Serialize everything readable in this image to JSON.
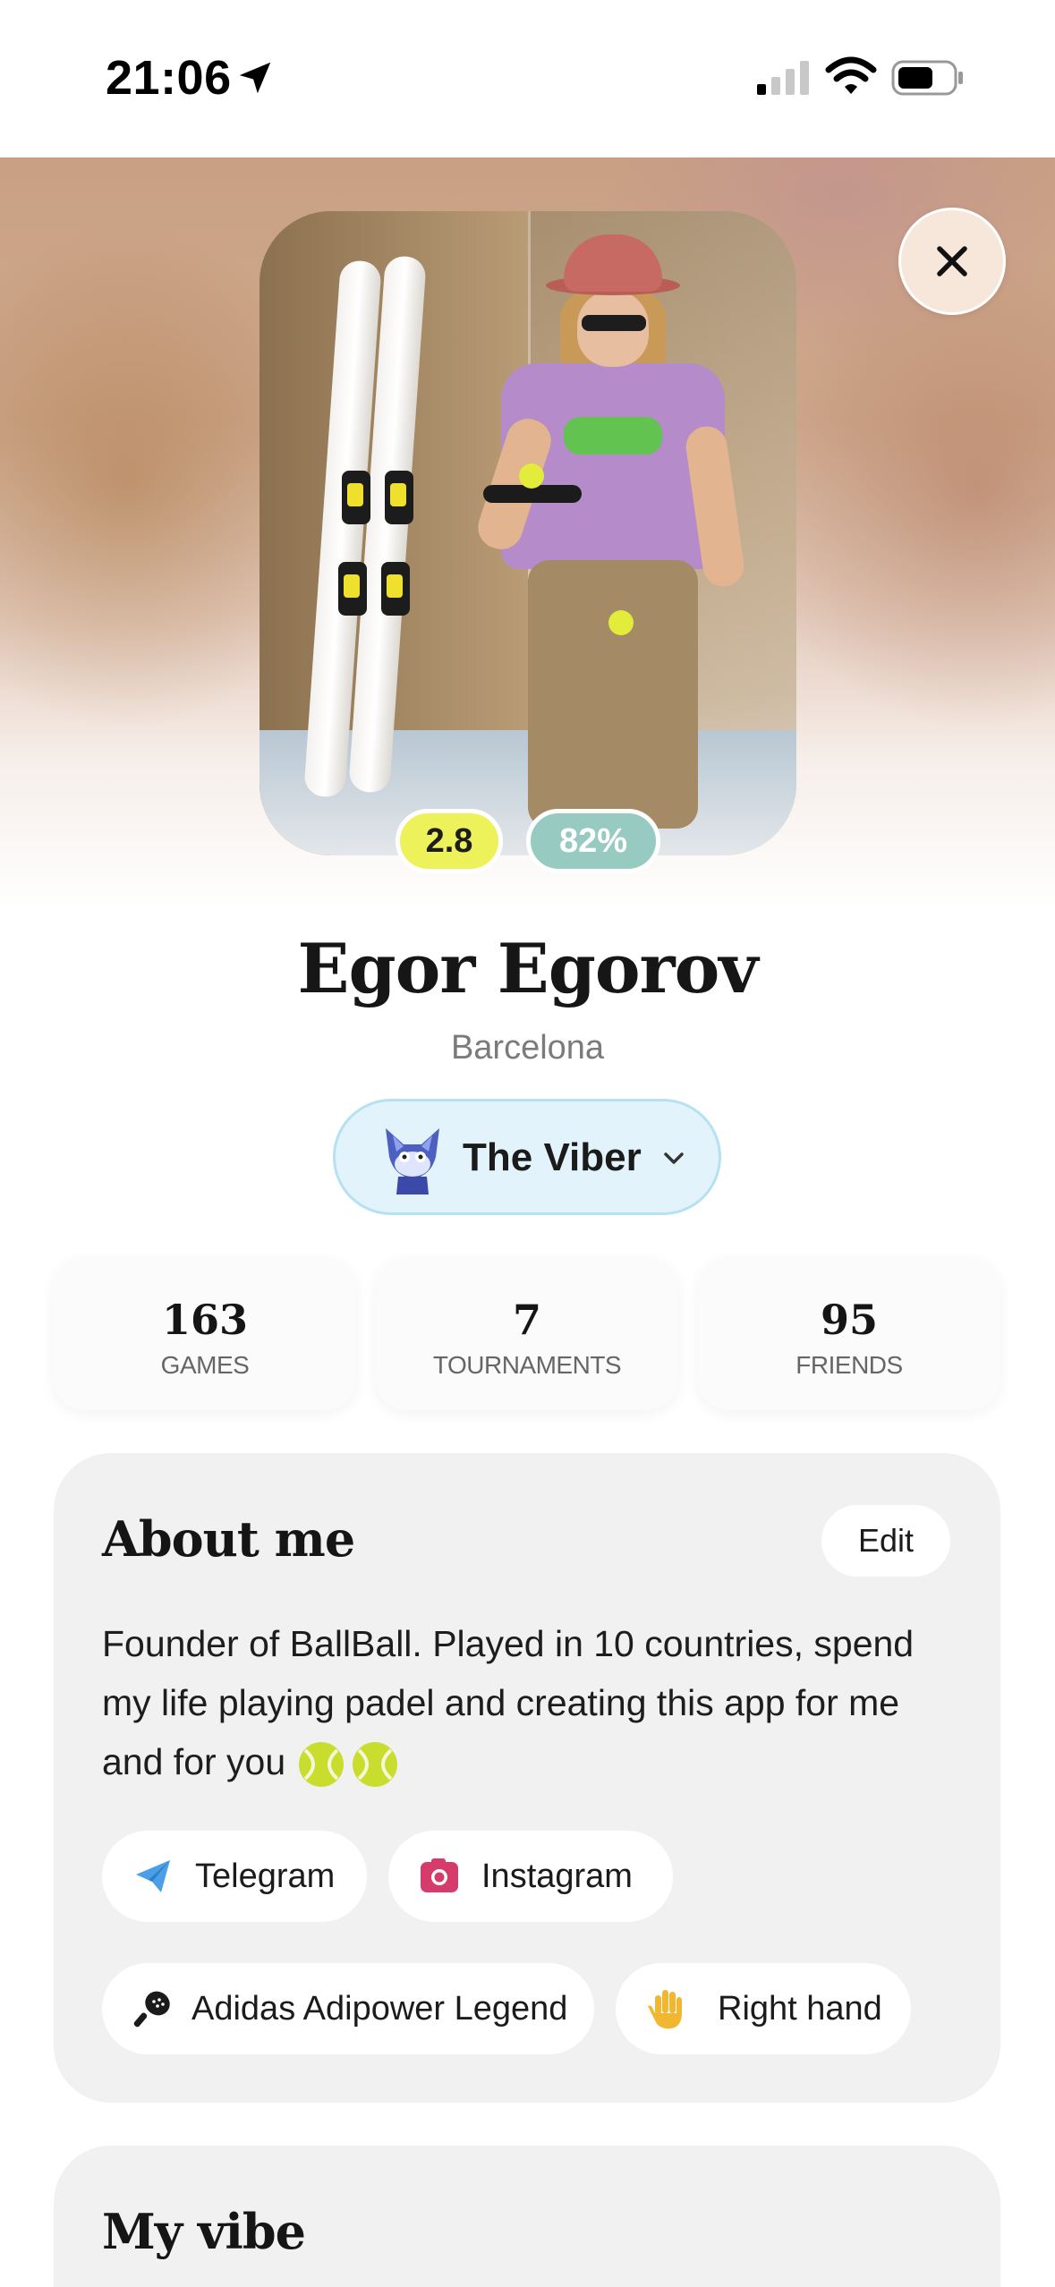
{
  "status_bar": {
    "time": "21:06",
    "icons": [
      "location-arrow-icon",
      "cellular-signal-icon",
      "wifi-icon",
      "battery-icon"
    ]
  },
  "profile": {
    "photo_alt": "Profile photo",
    "rating": "2.8",
    "percent": "82%",
    "name": "Egor Egorov",
    "city": "Barcelona",
    "vibe": {
      "label": "The Viber",
      "icon": "viber-fox-avatar-icon"
    }
  },
  "stats": [
    {
      "value": "163",
      "label": "GAMES"
    },
    {
      "value": "7",
      "label": "TOURNAMENTS"
    },
    {
      "value": "95",
      "label": "FRIENDS"
    }
  ],
  "about": {
    "title": "About me",
    "edit_label": "Edit",
    "bio": "Founder of BallBall. Played in 10 countries, spend my life playing padel and creating this app for me and for you",
    "chips": [
      {
        "label": "Telegram",
        "icon": "telegram-icon"
      },
      {
        "label": "Instagram",
        "icon": "instagram-icon"
      },
      {
        "label": "Adidas Adipower Legend",
        "icon": "padel-racket-icon"
      },
      {
        "label": "Right hand",
        "icon": "raised-hand-icon"
      }
    ]
  },
  "my_vibe": {
    "title": "My vibe"
  },
  "colors": {
    "rating_pill": "#eef25a",
    "percent_pill": "#97cbc1",
    "vibe_pill_bg": "#e2f3fb",
    "card_bg": "#f1f1f1",
    "close_btn_bg": "#f7e7da"
  }
}
